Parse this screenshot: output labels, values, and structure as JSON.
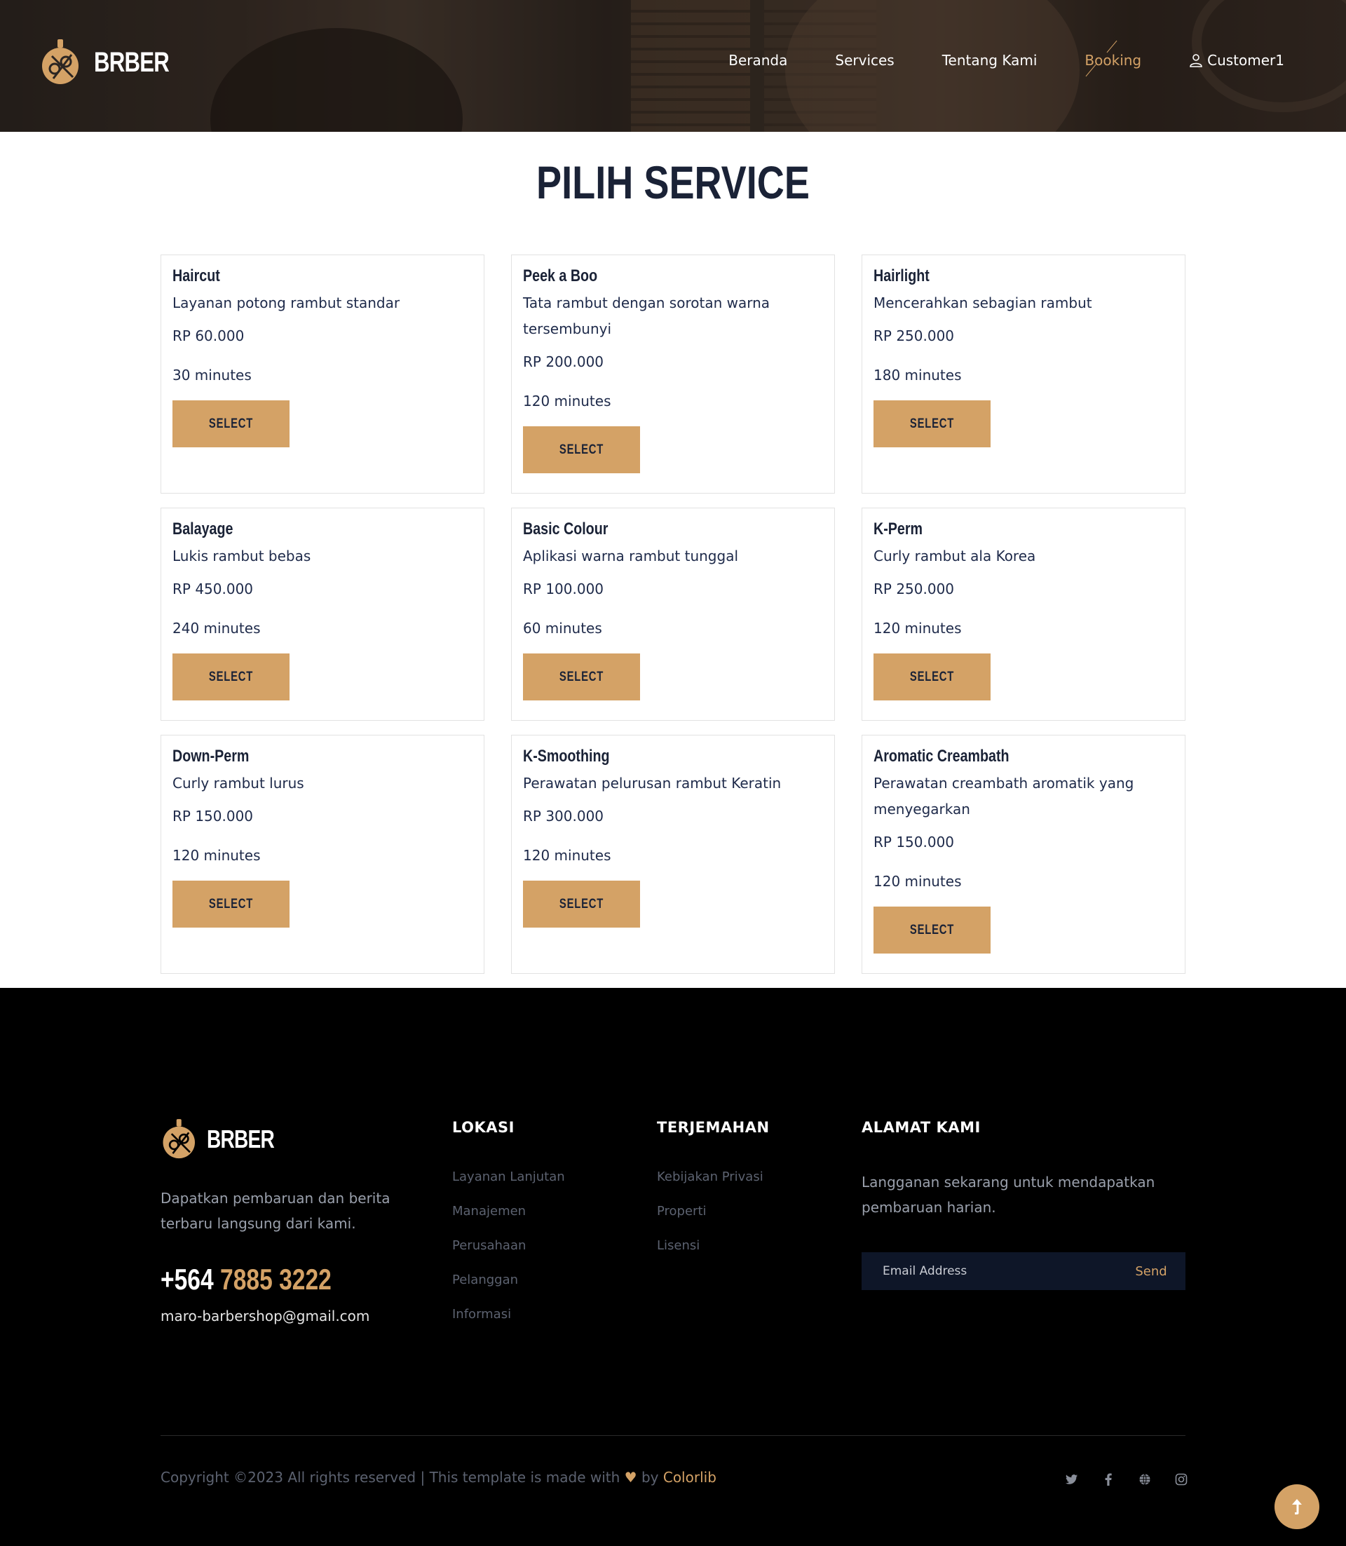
{
  "brand": {
    "name": "BRBER",
    "accent": "#d4a266"
  },
  "nav": {
    "items": [
      {
        "label": "Beranda"
      },
      {
        "label": "Services"
      },
      {
        "label": "Tentang Kami"
      },
      {
        "label": "Booking",
        "active": true
      }
    ],
    "user": {
      "label": "Customer1",
      "icon": "user-icon"
    }
  },
  "page": {
    "title": "PILIH SERVICE"
  },
  "services": [
    {
      "name": "Haircut",
      "description": "Layanan potong rambut standar",
      "price": "RP 60.000",
      "duration": "30 minutes",
      "button": "SELECT"
    },
    {
      "name": "Peek a Boo",
      "description": "Tata rambut dengan sorotan warna tersembunyi",
      "price": "RP 200.000",
      "duration": "120 minutes",
      "button": "SELECT"
    },
    {
      "name": "Hairlight",
      "description": "Mencerahkan sebagian rambut",
      "price": "RP 250.000",
      "duration": "180 minutes",
      "button": "SELECT"
    },
    {
      "name": "Balayage",
      "description": "Lukis rambut bebas",
      "price": "RP 450.000",
      "duration": "240 minutes",
      "button": "SELECT"
    },
    {
      "name": "Basic Colour",
      "description": "Aplikasi warna rambut tunggal",
      "price": "RP 100.000",
      "duration": "60 minutes",
      "button": "SELECT"
    },
    {
      "name": "K-Perm",
      "description": "Curly rambut ala Korea",
      "price": "RP 250.000",
      "duration": "120 minutes",
      "button": "SELECT"
    },
    {
      "name": "Down-Perm",
      "description": "Curly rambut lurus",
      "price": "RP 150.000",
      "duration": "120 minutes",
      "button": "SELECT"
    },
    {
      "name": "K-Smoothing",
      "description": "Perawatan pelurusan rambut Keratin",
      "price": "RP 300.000",
      "duration": "120 minutes",
      "button": "SELECT"
    },
    {
      "name": "Aromatic Creambath",
      "description": "Perawatan creambath aromatik yang menyegarkan",
      "price": "RP 150.000",
      "duration": "120 minutes",
      "button": "SELECT"
    }
  ],
  "footer": {
    "tagline": "Dapatkan pembaruan dan berita terbaru langsung dari kami.",
    "phone_prefix": "+564",
    "phone_rest": "7885 3222",
    "email": "maro-barbershop@gmail.com",
    "col1": {
      "title": "LOKASI",
      "links": [
        "Layanan Lanjutan",
        "Manajemen",
        "Perusahaan",
        "Pelanggan",
        "Informasi"
      ]
    },
    "col2": {
      "title": "TERJEMAHAN",
      "links": [
        "Kebijakan Privasi",
        "Properti",
        "Lisensi"
      ]
    },
    "col3": {
      "title": "ALAMAT KAMI",
      "text": "Langganan sekarang untuk mendapatkan pembaruan harian.",
      "placeholder": "Email Address",
      "send": "Send"
    },
    "copyright_prefix": "Copyright ©2023 All rights reserved | This template is made with",
    "copyright_by": "by",
    "copyright_link": "Colorlib",
    "socials": [
      "twitter-icon",
      "facebook-icon",
      "globe-icon",
      "instagram-icon"
    ]
  }
}
